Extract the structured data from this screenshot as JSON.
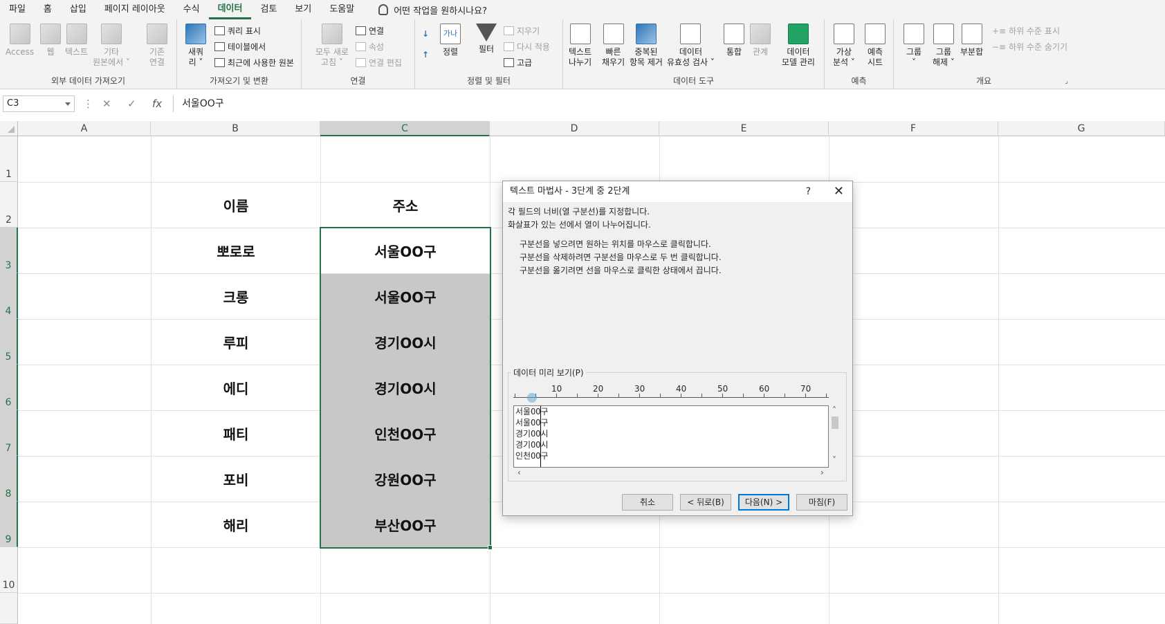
{
  "ribbon_tabs": [
    "파일",
    "홈",
    "삽입",
    "페이지 레이아웃",
    "수식",
    "데이터",
    "검토",
    "보기",
    "도움말"
  ],
  "active_tab": "데이터",
  "tell_me": "어떤 작업을 원하시나요?",
  "groups": {
    "external": {
      "label": "외부 데이터 가져오기",
      "access": "Access",
      "web": "웹",
      "text": "텍스트",
      "other_l1": "기타",
      "other_l2": "원본에서 ˅",
      "existing_l1": "기존",
      "existing_l2": "연결"
    },
    "transform": {
      "label": "가져오기 및 변환",
      "new_l1": "새쿼",
      "new_l2": "리 ˅",
      "show_queries": "쿼리 표시",
      "from_table": "테이블에서",
      "recent": "최근에 사용한 원본"
    },
    "connections": {
      "label": "연결",
      "refresh_l1": "모두 새로",
      "refresh_l2": "고침 ˅",
      "connections": "연결",
      "properties": "속성",
      "edit_links": "연결 편집"
    },
    "sortfilter": {
      "label": "정렬 및 필터",
      "sort": "정렬",
      "filter": "필터",
      "clear": "지우기",
      "reapply": "다시 적용",
      "advanced": "고급",
      "sort_icon": "가나"
    },
    "datatools": {
      "label": "데이터 도구",
      "text_to_col_l1": "텍스트",
      "text_to_col_l2": "나누기",
      "flash_l1": "빠른",
      "flash_l2": "채우기",
      "remove_dup_l1": "중복된",
      "remove_dup_l2": "항목 제거",
      "validation_l1": "데이터",
      "validation_l2": "유효성 검사 ˅",
      "consolidate": "통합",
      "relations": "관계",
      "model_l1": "데이터",
      "model_l2": "모델 관리"
    },
    "forecast": {
      "label": "예측",
      "whatif_l1": "가상",
      "whatif_l2": "분석 ˅",
      "sheet_l1": "예측",
      "sheet_l2": "시트"
    },
    "outline": {
      "label": "개요",
      "group_l1": "그룹",
      "group_l2": "˅",
      "ungroup_l1": "그룹",
      "ungroup_l2": "해제 ˅",
      "subtotal": "부분합",
      "show_detail": "하위 수준 표시",
      "hide_detail": "하위 수준 숨기기"
    }
  },
  "name_box": "C3",
  "formula_value": "서울OO구",
  "fx": "fx",
  "columns": [
    "A",
    "B",
    "C",
    "D",
    "E",
    "F",
    "G"
  ],
  "rows": [
    "1",
    "2",
    "3",
    "4",
    "5",
    "6",
    "7",
    "8",
    "9",
    "10"
  ],
  "header_row": {
    "name": "이름",
    "address": "주소"
  },
  "table": [
    {
      "name": "뽀로로",
      "address": "서울OO구"
    },
    {
      "name": "크롱",
      "address": "서울OO구"
    },
    {
      "name": "루피",
      "address": "경기OO시"
    },
    {
      "name": "에디",
      "address": "경기OO시"
    },
    {
      "name": "패티",
      "address": "인천OO구"
    },
    {
      "name": "포비",
      "address": "강원OO구"
    },
    {
      "name": "해리",
      "address": "부산OO구"
    }
  ],
  "dialog": {
    "title": "텍스트 마법사 - 3단계 중 2단계",
    "help": "?",
    "close": "✕",
    "line1": "각 필드의 너비(열 구분선)를 지정합니다.",
    "line2": "화살표가 있는 선에서 열이 나누어집니다.",
    "tip1": "구분선을 넣으려면 원하는 위치를 마우스로 클릭합니다.",
    "tip2": "구분선을 삭제하려면 구분선을 마우스로 두 번 클릭합니다.",
    "tip3": "구분선을 옮기려면 선을 마우스로 클릭한 상태에서 끕니다.",
    "preview_label": "데이터 미리 보기(P)",
    "ruler": [
      "10",
      "20",
      "30",
      "40",
      "50",
      "60",
      "70"
    ],
    "preview_rows": [
      "서울OO구",
      "서울OO구",
      "경기OO시",
      "경기OO시",
      "인천OO구"
    ],
    "buttons": {
      "cancel": "취소",
      "back": "< 뒤로(B)",
      "next": "다음(N) >",
      "finish": "마침(F)"
    }
  }
}
